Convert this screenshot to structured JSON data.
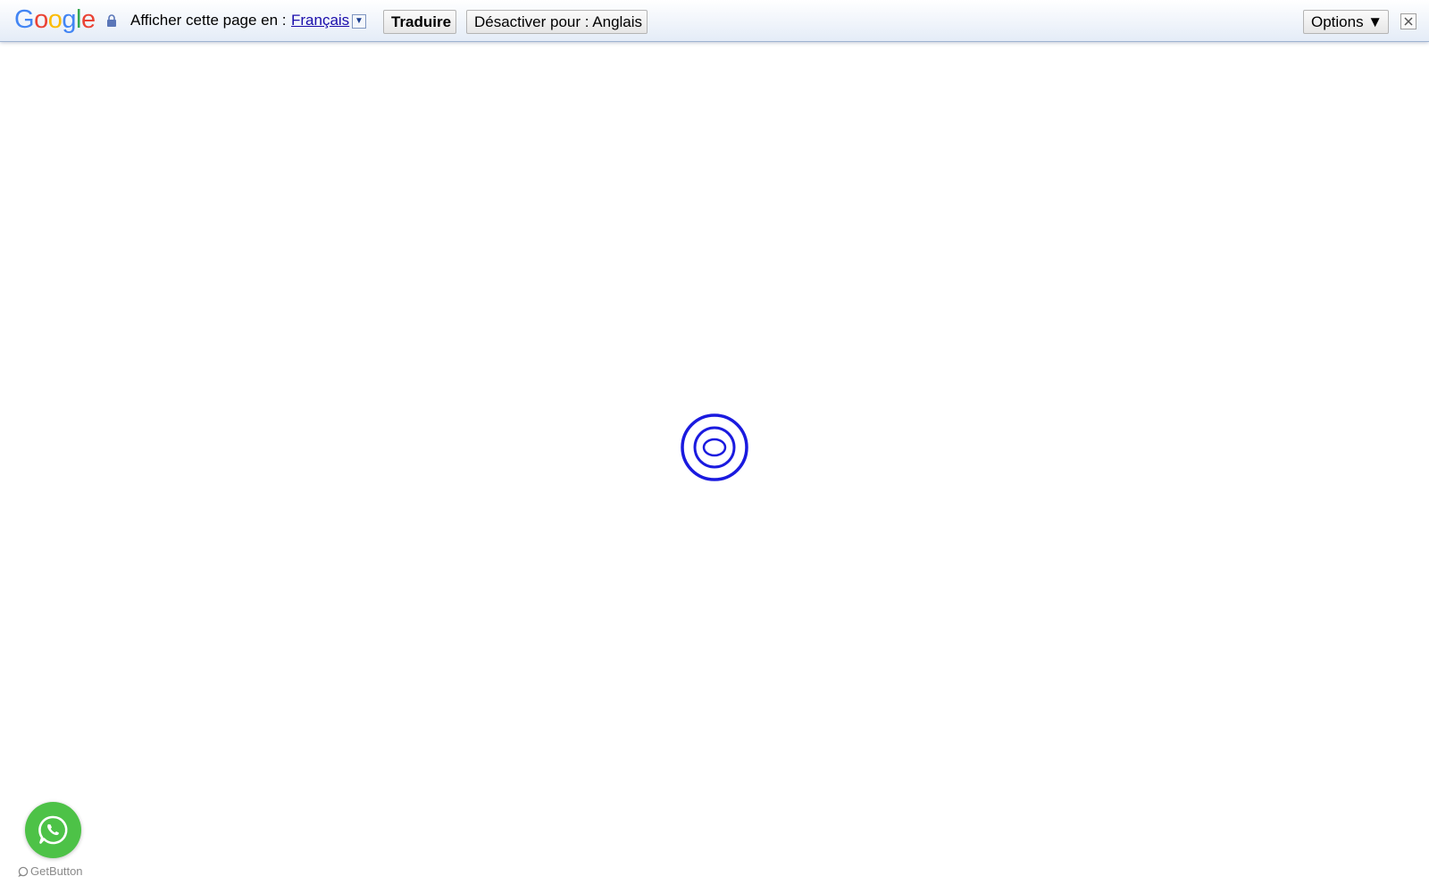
{
  "translate_bar": {
    "logo_letters": [
      {
        "char": "G",
        "color": "#4285f4"
      },
      {
        "char": "o",
        "color": "#ea4335"
      },
      {
        "char": "o",
        "color": "#fbbc05"
      },
      {
        "char": "g",
        "color": "#4285f4"
      },
      {
        "char": "l",
        "color": "#34a853"
      },
      {
        "char": "e",
        "color": "#ea4335"
      }
    ],
    "prompt": "Afficher cette page en :",
    "language": "Français",
    "dropdown_glyph": "▼",
    "translate_label": "Traduire",
    "disable_label": "Désactiver pour : Anglais",
    "options_label": "Options ▼"
  },
  "loader": {
    "icon": "loading-spinner-icon",
    "color": "#1a1adf"
  },
  "whatsapp_widget": {
    "icon": "whatsapp-icon",
    "color": "#4dc247",
    "credit_label": "GetButton"
  }
}
